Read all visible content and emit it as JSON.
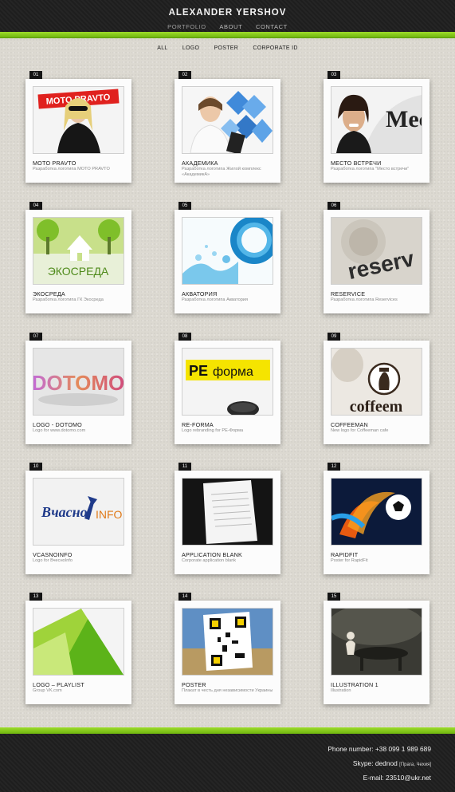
{
  "header": {
    "title": "ALEXANDER YERSHOV",
    "nav": [
      {
        "label": "PORTFOLIO",
        "active": true
      },
      {
        "label": "ABOUT",
        "active": false
      },
      {
        "label": "CONTACT",
        "active": false
      }
    ]
  },
  "filters": [
    "ALL",
    "LOGO",
    "POSTER",
    "CORPORATE ID"
  ],
  "colors": {
    "accent": "#8fd21b",
    "dark": "#1e1e1e",
    "background": "#dcd9d1"
  },
  "portfolio": [
    {
      "num": "01",
      "title": "MOTO PRAVTO",
      "subtitle": "Разработка логотипа MOTO PRAVTO"
    },
    {
      "num": "02",
      "title": "АКАДЕМИКА",
      "subtitle": "Разработка логотипа Жилой комплекс «АкадемикА»"
    },
    {
      "num": "03",
      "title": "МЕСТО ВСТРЕЧИ",
      "subtitle": "Разработка логотипа \"Место встречи\""
    },
    {
      "num": "04",
      "title": "ЭКОСРЕДА",
      "subtitle": "Разработка логотипа ГК Экосреда"
    },
    {
      "num": "05",
      "title": "АКВАТОРИЯ",
      "subtitle": "Разработка логотипа Акватория"
    },
    {
      "num": "06",
      "title": "RESERVICE",
      "subtitle": "Разработка логотипа Reservices"
    },
    {
      "num": "07",
      "title": "LOGO - DOTOMO",
      "subtitle": "Logo for www.dotomo.com"
    },
    {
      "num": "08",
      "title": "RE-FORMA",
      "subtitle": "Logo rebranding for РЕ-Форма"
    },
    {
      "num": "09",
      "title": "COFFEEMAN",
      "subtitle": "New logo for Coffeeman cafe"
    },
    {
      "num": "10",
      "title": "VCASNOINFO",
      "subtitle": "Logo for ВчесноInfo"
    },
    {
      "num": "11",
      "title": "APPLICATION BLANK",
      "subtitle": "Corporate application blank"
    },
    {
      "num": "12",
      "title": "RAPIDFIT",
      "subtitle": "Poster for RapidFit"
    },
    {
      "num": "13",
      "title": "LOGO – PLAYLIST",
      "subtitle": "Group VK.com"
    },
    {
      "num": "14",
      "title": "POSTER",
      "subtitle": "Плакат в честь дня независимости Украины"
    },
    {
      "num": "15",
      "title": "ILLUSTRATION 1",
      "subtitle": "Illustration"
    }
  ],
  "thumb_text": {
    "moto": "MOTO PRAVTO",
    "eco": "ЭКОСРЕДА",
    "reserv": "reserv",
    "dotomo": "DOTOMO",
    "reforma_re": "РЕ",
    "reforma_forma": "форма",
    "coffee": "coffeem",
    "vcasno": "Вчасно",
    "info": "INFO",
    "mesto": "Mec"
  },
  "footer": {
    "phone": "Phone number: +38 099 1 989 689",
    "skype": "Skype: dednod",
    "skype_note": "[Прага, Чехия]",
    "email": "E-mail: 23510@ukr.net"
  }
}
